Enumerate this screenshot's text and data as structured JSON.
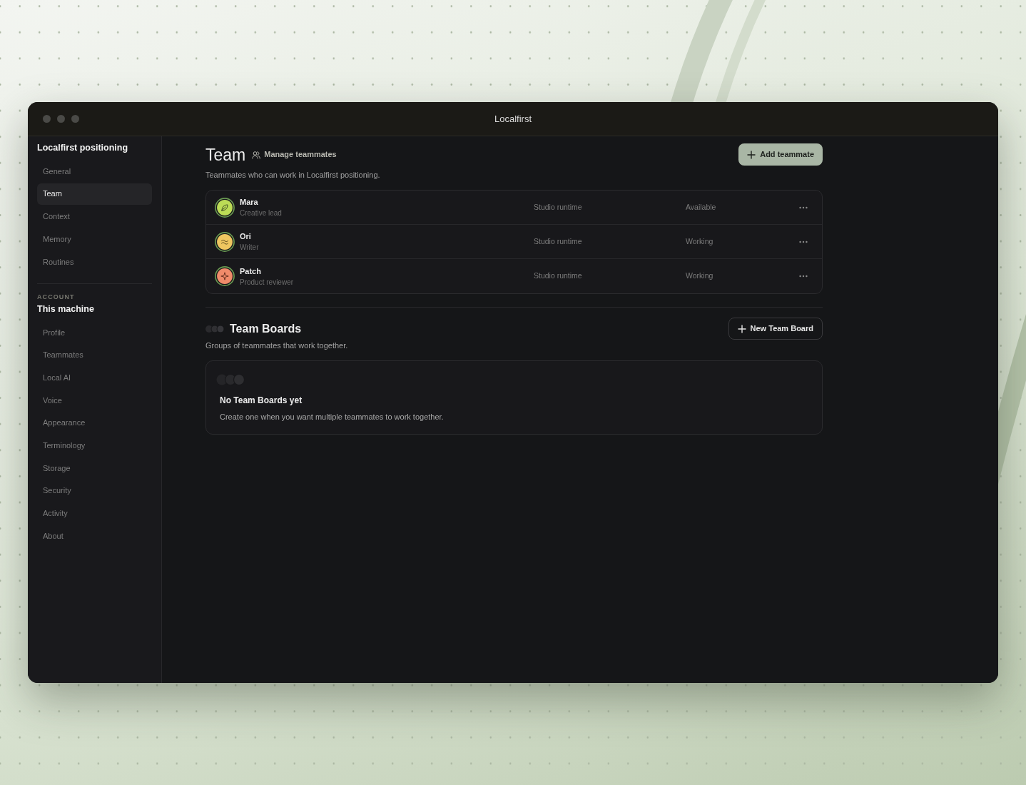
{
  "window": {
    "title": "Localfirst"
  },
  "sidebar": {
    "sections": [
      {
        "title": "Localfirst positioning",
        "items": [
          {
            "label": "General",
            "selected": false
          },
          {
            "label": "Team",
            "selected": true
          },
          {
            "label": "Context",
            "selected": false
          },
          {
            "label": "Memory",
            "selected": false
          },
          {
            "label": "Routines",
            "selected": false
          }
        ]
      },
      {
        "label": "ACCOUNT",
        "title": "This machine",
        "items": [
          {
            "label": "Profile",
            "selected": false
          },
          {
            "label": "Teammates",
            "selected": false
          },
          {
            "label": "Local AI",
            "selected": false
          },
          {
            "label": "Voice",
            "selected": false
          },
          {
            "label": "Appearance",
            "selected": false
          },
          {
            "label": "Terminology",
            "selected": false
          },
          {
            "label": "Storage",
            "selected": false
          },
          {
            "label": "Security",
            "selected": false
          },
          {
            "label": "Activity",
            "selected": false
          },
          {
            "label": "About",
            "selected": false
          }
        ]
      }
    ]
  },
  "team": {
    "title": "Team",
    "manage_link": "Manage teammates",
    "add_button": "Add teammate",
    "description": "Teammates who can work in Localfirst positioning.",
    "teammates": [
      {
        "name": "Mara",
        "role": "Creative lead",
        "runtime": "Studio runtime",
        "status": "Available",
        "color": "#bcdc56"
      },
      {
        "name": "Ori",
        "role": "Writer",
        "runtime": "Studio runtime",
        "status": "Working",
        "color": "#eec660"
      },
      {
        "name": "Patch",
        "role": "Product reviewer",
        "runtime": "Studio runtime",
        "status": "Working",
        "color": "#f08b6a"
      }
    ]
  },
  "boards": {
    "title": "Team Boards",
    "new_button": "New Team Board",
    "description": "Groups of teammates that work together.",
    "empty_state": {
      "title": "No Team Boards yet",
      "message": "Create one when you want multiple teammates to work together."
    }
  }
}
